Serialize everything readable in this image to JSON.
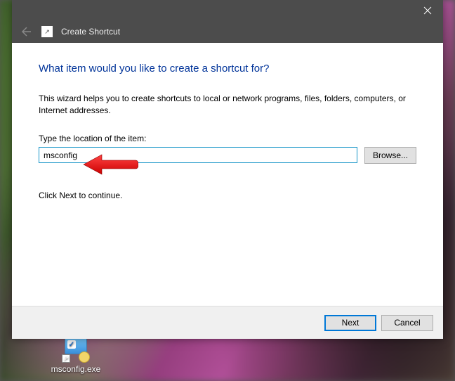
{
  "window": {
    "title": "Create Shortcut",
    "heading": "What item would you like to create a shortcut for?",
    "description": "This wizard helps you to create shortcuts to local or network programs, files, folders, computers, or Internet addresses.",
    "field_label": "Type the location of the item:",
    "location_value": "msconfig",
    "browse_label": "Browse...",
    "continue_text": "Click Next to continue.",
    "next_label": "Next",
    "cancel_label": "Cancel"
  },
  "desktop": {
    "icon_label": "msconfig.exe"
  }
}
